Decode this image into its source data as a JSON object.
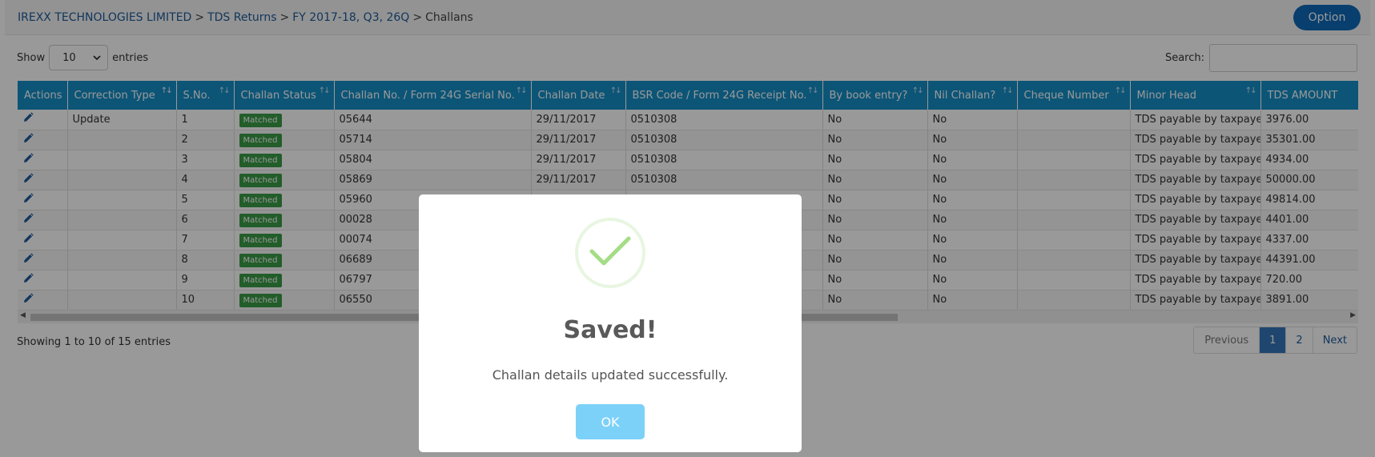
{
  "breadcrumb": {
    "company": "IREXX TECHNOLOGIES LIMITED",
    "section": "TDS Returns",
    "period": "FY 2017-18, Q3, 26Q",
    "current": "Challans",
    "separator": ">"
  },
  "option_label": "Option",
  "length": {
    "show_label": "Show",
    "selected": "10",
    "entries_label": "entries"
  },
  "search": {
    "label": "Search:",
    "value": "",
    "placeholder": ""
  },
  "table": {
    "columns": [
      "Actions",
      "Correction Type",
      "S.No.",
      "Challan Status",
      "Challan No. / Form 24G Serial No.",
      "Challan Date",
      "BSR Code / Form 24G Receipt No.",
      "By book entry?",
      "Nil Challan?",
      "Cheque Number",
      "Minor Head",
      "TDS AMOUNT"
    ],
    "rows": [
      {
        "correction": "Update",
        "sno": "1",
        "status": "Matched",
        "challan": "05644",
        "date": "29/11/2017",
        "bsr": "0510308",
        "book": "No",
        "nil": "No",
        "cheque": "",
        "minor": "TDS payable by taxpayer",
        "amount": "3976.00"
      },
      {
        "correction": "",
        "sno": "2",
        "status": "Matched",
        "challan": "05714",
        "date": "29/11/2017",
        "bsr": "0510308",
        "book": "No",
        "nil": "No",
        "cheque": "",
        "minor": "TDS payable by taxpayer",
        "amount": "35301.00"
      },
      {
        "correction": "",
        "sno": "3",
        "status": "Matched",
        "challan": "05804",
        "date": "29/11/2017",
        "bsr": "0510308",
        "book": "No",
        "nil": "No",
        "cheque": "",
        "minor": "TDS payable by taxpayer",
        "amount": "4934.00"
      },
      {
        "correction": "",
        "sno": "4",
        "status": "Matched",
        "challan": "05869",
        "date": "29/11/2017",
        "bsr": "0510308",
        "book": "No",
        "nil": "No",
        "cheque": "",
        "minor": "TDS payable by taxpayer",
        "amount": "50000.00"
      },
      {
        "correction": "",
        "sno": "5",
        "status": "Matched",
        "challan": "05960",
        "date": "",
        "bsr": "",
        "book": "No",
        "nil": "No",
        "cheque": "",
        "minor": "TDS payable by taxpayer",
        "amount": "49814.00"
      },
      {
        "correction": "",
        "sno": "6",
        "status": "Matched",
        "challan": "00028",
        "date": "",
        "bsr": "",
        "book": "No",
        "nil": "No",
        "cheque": "",
        "minor": "TDS payable by taxpayer",
        "amount": "4401.00"
      },
      {
        "correction": "",
        "sno": "7",
        "status": "Matched",
        "challan": "00074",
        "date": "",
        "bsr": "",
        "book": "No",
        "nil": "No",
        "cheque": "",
        "minor": "TDS payable by taxpayer",
        "amount": "4337.00"
      },
      {
        "correction": "",
        "sno": "8",
        "status": "Matched",
        "challan": "06689",
        "date": "",
        "bsr": "",
        "book": "No",
        "nil": "No",
        "cheque": "",
        "minor": "TDS payable by taxpayer",
        "amount": "44391.00"
      },
      {
        "correction": "",
        "sno": "9",
        "status": "Matched",
        "challan": "06797",
        "date": "",
        "bsr": "",
        "book": "No",
        "nil": "No",
        "cheque": "",
        "minor": "TDS payable by taxpayer",
        "amount": "720.00"
      },
      {
        "correction": "",
        "sno": "10",
        "status": "Matched",
        "challan": "06550",
        "date": "",
        "bsr": "",
        "book": "No",
        "nil": "No",
        "cheque": "",
        "minor": "TDS payable by taxpayer",
        "amount": "3891.00"
      }
    ]
  },
  "info_text": "Showing 1 to 10 of 15 entries",
  "pagination": {
    "previous": "Previous",
    "pages": [
      "1",
      "2"
    ],
    "current": "1",
    "next": "Next"
  },
  "modal": {
    "title": "Saved!",
    "text": "Challan details updated successfully.",
    "ok_label": "OK",
    "icon": "success-check-icon"
  },
  "colors": {
    "header_blue": "#158ec6",
    "link": "#1d5a9a",
    "option_button": "#0e6ab8",
    "badge_green": "#3a9b47",
    "check_green": "#a5dc86",
    "ok_button": "#7cd1f9",
    "pagination_active": "#3576b8"
  }
}
